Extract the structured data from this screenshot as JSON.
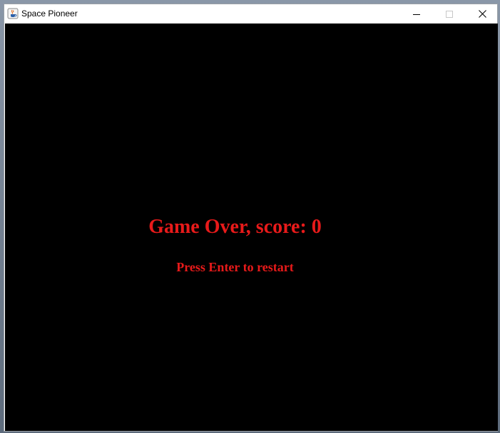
{
  "window": {
    "title": "Space Pioneer",
    "app_icon": "java-cup-icon",
    "controls": {
      "minimize_icon": "minimize-icon",
      "maximize_icon": "maximize-icon",
      "close_icon": "close-icon"
    }
  },
  "game": {
    "game_over_text": "Game Over, score: 0",
    "restart_hint": "Press Enter to restart",
    "text_color": "#e81a1a",
    "background_color": "#000000"
  }
}
